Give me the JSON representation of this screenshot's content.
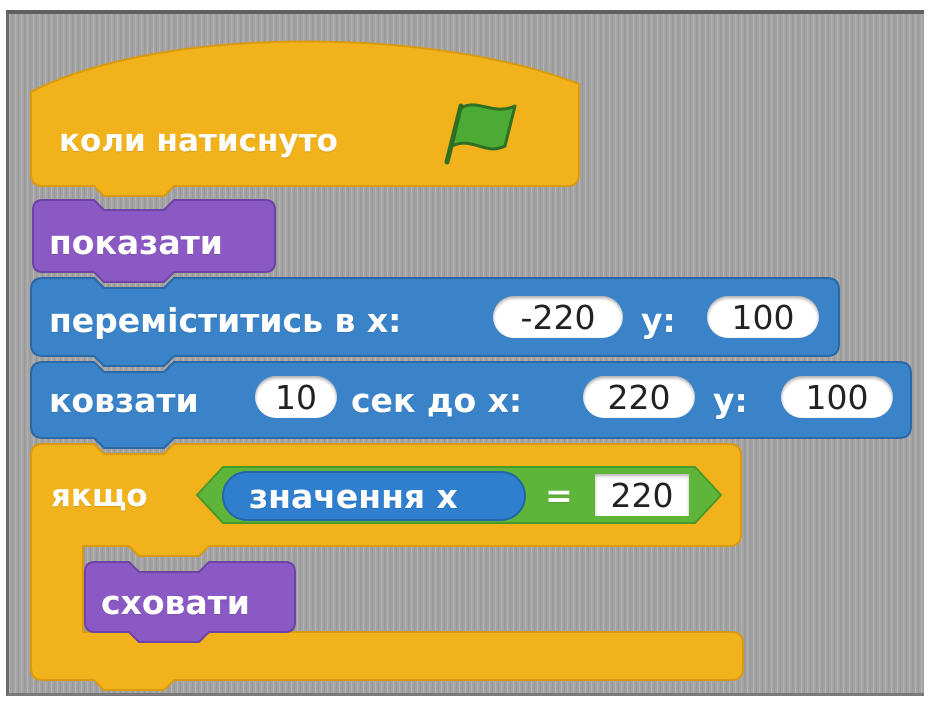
{
  "colors": {
    "events": "#f2b21c",
    "looks": "#8a59c4",
    "motion": "#3a83c9",
    "sensing": "#2f7fce",
    "operators": "#5fb43a",
    "flag": "#4bab34"
  },
  "blocks": {
    "when_flag": {
      "label": "коли натиснуто",
      "icon": "green-flag-icon"
    },
    "show": {
      "label": "показати"
    },
    "goto_xy": {
      "label": "переміститись в x:",
      "x": "-220",
      "y_label": "y:",
      "y": "100"
    },
    "glide": {
      "label": "ковзати",
      "secs": "10",
      "mid_label": "сек до x:",
      "x": "220",
      "y_label": "y:",
      "y": "100"
    },
    "if": {
      "label": "якщо",
      "condition": {
        "reporter": "значення x",
        "operator": "=",
        "value": "220"
      }
    },
    "hide": {
      "label": "сховати"
    }
  }
}
